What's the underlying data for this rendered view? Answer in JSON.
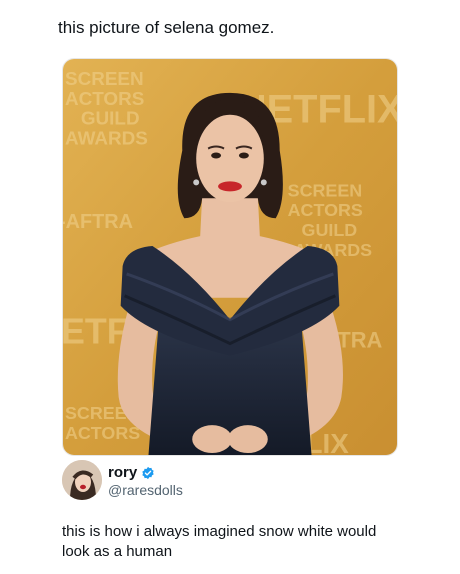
{
  "post": {
    "caption": "this picture of selena gomez."
  },
  "photo": {
    "backdrop_words": {
      "sag_left": [
        "SCREEN",
        "ACTORS",
        "GUILD",
        "AWARDS"
      ],
      "netflix_top": "NETFLIX",
      "sag_right": [
        "SCREEN",
        "ACTORS",
        "GUILD",
        "AWARDS"
      ],
      "aftra_left": "-AFTRA",
      "netflix_mid_left": "ETF",
      "aftra_right": "TRA",
      "sag_bottom_left": [
        "SCREEN",
        "ACTORS"
      ],
      "netflix_bottom": "LIX"
    },
    "colors": {
      "backdrop": "#d9a441",
      "dress": "#1d2536",
      "hair": "#2a1c16",
      "skin": "#e9c0a4",
      "lips": "#c7262a"
    }
  },
  "tweet": {
    "display_name": "rory",
    "handle": "@raresdolls",
    "verified_icon": "verified-badge-icon",
    "text": "this is how i always imagined snow white would look as a human",
    "verified_color": "#1d9bf0"
  }
}
